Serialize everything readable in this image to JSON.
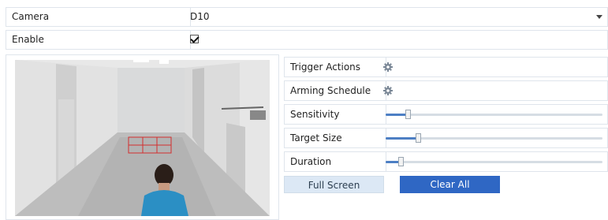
{
  "camera": {
    "label": "Camera",
    "value": "D10"
  },
  "enable": {
    "label": "Enable",
    "checked": true
  },
  "panel": {
    "trigger_actions": "Trigger Actions",
    "arming_schedule": "Arming Schedule",
    "sliders": [
      {
        "label": "Sensitivity",
        "value": 0.1
      },
      {
        "label": "Target Size",
        "value": 0.15
      },
      {
        "label": "Duration",
        "value": 0.07
      }
    ]
  },
  "buttons": {
    "full_screen": "Full Screen",
    "clear_all": "Clear All"
  },
  "icons": {
    "dropdown": "chevron-down-icon",
    "settings": "gear-icon",
    "checkbox": "check-icon"
  },
  "colors": {
    "accent": "#2f67c4",
    "slider_fill": "#4d7fc4",
    "zone": "#d32f2f"
  }
}
